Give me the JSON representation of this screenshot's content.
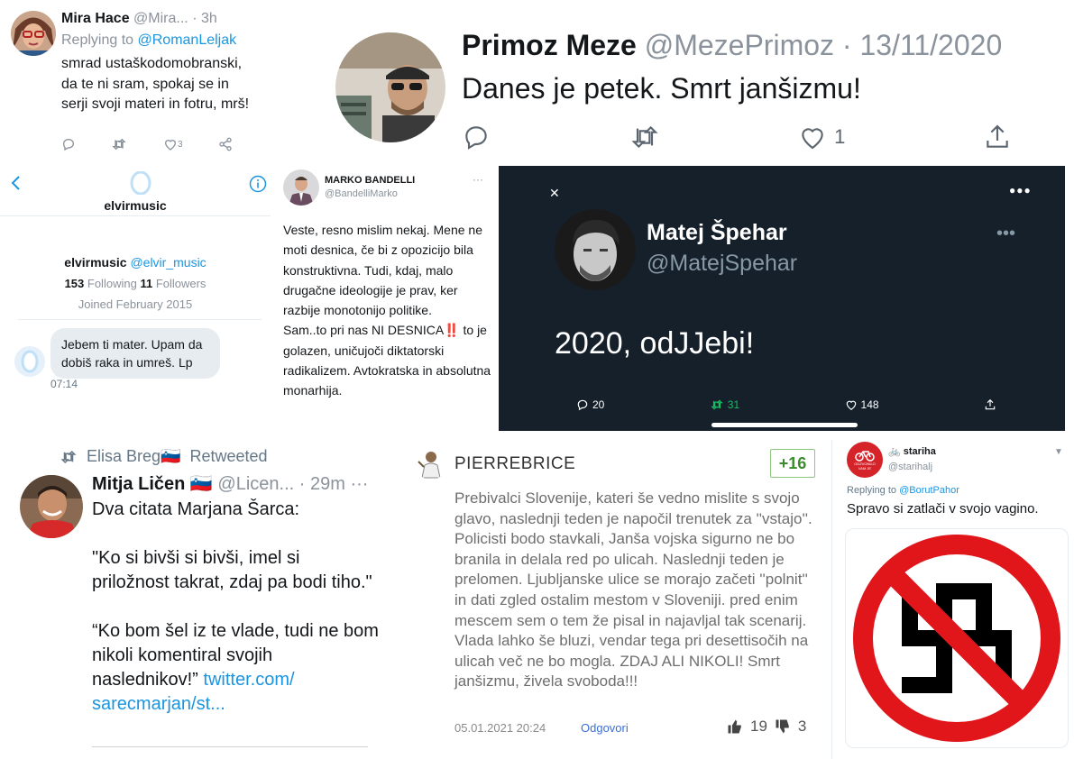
{
  "mira": {
    "name": "Mira Hace",
    "handle": "@Mira...",
    "time": "· 3h",
    "replying_prefix": "Replying to ",
    "replying_to": "@RomanLeljak",
    "text": "smrad ustaškodomobranski, da te ni sram, spokaj se in serji svoji materi in fotru, mrš!",
    "likes": "3"
  },
  "primoz": {
    "name": "Primoz Meze",
    "handle": "@MezePrimoz",
    "date": "· 13/11/2020",
    "text": "Danes je petek. Smrt janšizmu!",
    "likes": "1"
  },
  "elvir": {
    "header_name": "elvirmusic",
    "display_name": "elvirmusic",
    "handle": "@elvir_music",
    "following_count": "153",
    "following_label": "Following",
    "followers_count": "11",
    "followers_label": "Followers",
    "joined": "Joined February 2015",
    "message": "Jebem ti mater. Upam da dobiš raka in umreš. Lp",
    "message_time": "07:14"
  },
  "marko": {
    "name": "MARKO BANDELLI",
    "handle": "@BandelliMarko",
    "text_1": "Veste, resno mislim nekaj. Mene ne moti desnica, če bi z opozicijo bila konstruktivna. Tudi, kdaj, malo drugačne ideologije je prav, ker razbije monotonijo politike.",
    "text_2a": "Sam..to pri nas NI DESNICA",
    "text_2_emoji": "‼️",
    "text_2b": " to je golazen, uničujoči diktatorski radikalizem. Avtokratska in absolutna monarhija."
  },
  "matej": {
    "name": "Matej Špehar",
    "handle": "@MatejSpehar",
    "text": "2020, odJJebi!",
    "replies": "20",
    "retweets": "31",
    "likes": "148"
  },
  "mitja": {
    "retweeted_by": "Elisa Breg",
    "retweeted_flag": "🇸🇮",
    "retweeted_label": "Retweeted",
    "name": "Mitja Ličen",
    "flag": "🇸🇮",
    "handle": "@Licen...",
    "time": "· 29m",
    "line_1": "Dva citata Marjana Šarca:",
    "quote_1": "\"Ko si bivši si bivši, imel si priložnost takrat, zdaj pa bodi tiho.\"",
    "quote_2": "“Ko bom šel iz te vlade, tudi ne bom nikoli komentiral svojih naslednikov!”",
    "link": "twitter.com/ sarecmarjan/st..."
  },
  "pierre": {
    "name": "PIERREBRICE",
    "score": "+16",
    "text": "Prebivalci Slovenije, kateri še vedno mislite s svojo glavo, naslednji teden je napočil trenutek za ''vstajo''. Policisti bodo stavkali, Janša vojska sigurno ne bo branila in delala red po ulicah. Naslednji teden je prelomen. Ljubljanske ulice se morajo začeti ''polnit'' in dati zgled ostalim mestom v Sloveniji. pred enim mescem sem o tem že pisal in najavljal tak scenarij. Vlada lahko še bluzi, vendar tega pri desettisočih na ulicah več ne bo mogla. ZDAJ ALI NIKOLI! Smrt janšizmu, živela svoboda!!!",
    "datetime": "05.01.2021 20:24",
    "reply_label": "Odgovori",
    "upvotes": "19",
    "downvotes": "3"
  },
  "stariha": {
    "name": "stariha",
    "handle": "@starihalj",
    "avatar_text": "ODZVONILO VAM JE",
    "replying_prefix": "Replying to ",
    "replying_to": "@BorutPahor",
    "text": "Spravo si zatlači v svojo vagino."
  }
}
